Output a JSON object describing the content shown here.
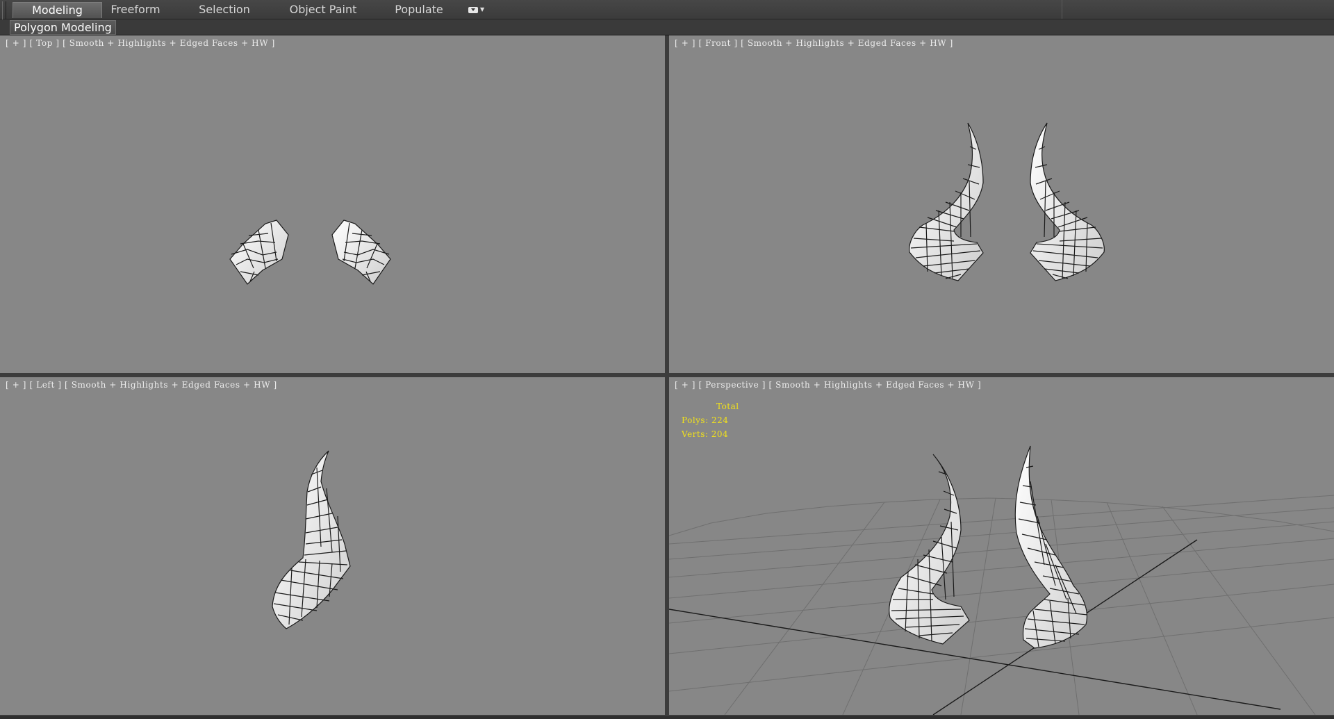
{
  "ribbon": {
    "tabs": [
      {
        "label": "Modeling",
        "active": true
      },
      {
        "label": "Freeform",
        "active": false
      },
      {
        "label": "Selection",
        "active": false
      },
      {
        "label": "Object Paint",
        "active": false
      },
      {
        "label": "Populate",
        "active": false
      }
    ],
    "panel_label": "Polygon Modeling"
  },
  "viewports": {
    "top": {
      "plus": "[ + ]",
      "name": "[ Top ]",
      "shading": "[ Smooth + Highlights + Edged Faces + HW ]"
    },
    "front": {
      "plus": "[ + ]",
      "name": "[ Front ]",
      "shading": "[ Smooth + Highlights + Edged Faces + HW ]"
    },
    "left": {
      "plus": "[ + ]",
      "name": "[ Left ]",
      "shading": "[ Smooth + Highlights + Edged Faces + HW ]"
    },
    "perspective": {
      "plus": "[ + ]",
      "name": "[ Perspective ]",
      "shading": "[ Smooth + Highlights + Edged Faces + HW ]"
    }
  },
  "stats": {
    "total_label": "Total",
    "polys_label": "Polys:",
    "polys_value": "224",
    "verts_label": "Verts:",
    "verts_value": "204"
  },
  "colors": {
    "viewport_bg": "#878787",
    "stats_text": "#f2e21a",
    "mesh_fill": "#f2f2f2",
    "mesh_edge": "#1a1a1a"
  }
}
